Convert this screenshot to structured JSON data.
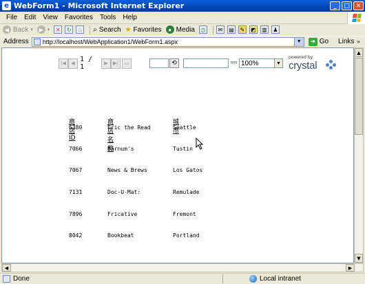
{
  "window": {
    "title": "WebForm1 - Microsoft Internet Explorer",
    "app_icon": "ie-icon"
  },
  "menubar": {
    "items": [
      "File",
      "Edit",
      "View",
      "Favorites",
      "Tools",
      "Help"
    ]
  },
  "toolbar": {
    "back_label": "Back",
    "search_label": "Search",
    "favorites_label": "Favorites",
    "media_label": "Media"
  },
  "address": {
    "label": "Address",
    "url": "http://localhost/WebApplication1/WebForm1.aspx",
    "go_label": "Go",
    "links_label": "Links"
  },
  "report_viewer": {
    "page_info": "1 / 1",
    "zoom": "100%",
    "powered_by": "powered by",
    "brand": "crystal"
  },
  "report": {
    "headers": [
      "商店ID",
      "商店名称",
      "城市"
    ],
    "rows": [
      [
        "6380",
        "Eric the Read",
        "Seattle"
      ],
      [
        "7066",
        "Barnum's",
        "Tustin"
      ],
      [
        "7067",
        "News & Brews",
        "Los Gatos"
      ],
      [
        "7131",
        "Doc-U-Mat:",
        "Remulade"
      ],
      [
        "7896",
        "Fricative",
        "Fremont"
      ],
      [
        "8042",
        "Bookbeat",
        "Portland"
      ]
    ]
  },
  "status": {
    "text": "Done",
    "zone": "Local intranet"
  }
}
